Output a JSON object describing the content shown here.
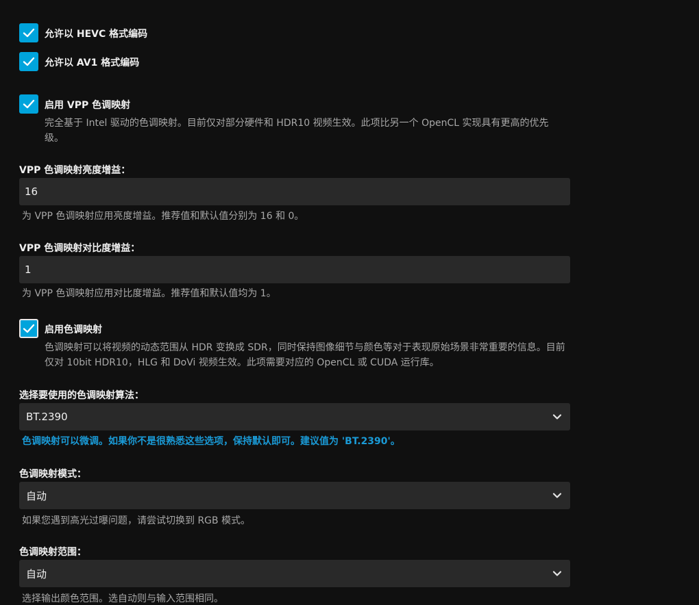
{
  "checkboxes": {
    "hevc": {
      "label": "允许以 HEVC 格式编码",
      "checked": true
    },
    "av1": {
      "label": "允许以 AV1 格式编码",
      "checked": true
    },
    "vpp_tonemap": {
      "label": "启用 VPP 色调映射",
      "checked": true,
      "description": "完全基于 Intel 驱动的色调映射。目前仅对部分硬件和 HDR10 视频生效。此项比另一个 OpenCL 实现具有更高的优先级。"
    },
    "tonemap": {
      "label": "启用色调映射",
      "checked": true,
      "description": "色调映射可以将视频的动态范围从 HDR 变换成 SDR，同时保持图像细节与颜色等对于表现原始场景非常重要的信息。目前仅对 10bit HDR10，HLG 和 DoVi 视频生效。此项需要对应的 OpenCL 或 CUDA 运行库。"
    }
  },
  "fields": {
    "vpp_brightness": {
      "label": "VPP 色调映射亮度增益：",
      "value": "16",
      "hint": "为 VPP 色调映射应用亮度增益。推荐值和默认值分别为 16 和 0。"
    },
    "vpp_contrast": {
      "label": "VPP 色调映射对比度增益：",
      "value": "1",
      "hint": "为 VPP 色调映射应用对比度增益。推荐值和默认值均为 1。"
    },
    "algorithm": {
      "label": "选择要使用的色调映射算法：",
      "value": "BT.2390",
      "hint": "色调映射可以微调。如果你不是很熟悉这些选项，保持默认即可。建议值为 'BT.2390'。"
    },
    "mode": {
      "label": "色调映射模式：",
      "value": "自动",
      "hint": "如果您遇到高光过曝问题，请尝试切换到 RGB 模式。"
    },
    "range": {
      "label": "色调映射范围：",
      "value": "自动",
      "hint": "选择输出颜色范围。选自动则与输入范围相同。"
    }
  },
  "colors": {
    "accent": "#00a4dc",
    "background": "#101010",
    "input_bg": "#292929"
  },
  "icons": {
    "checkmark": "check-icon",
    "dropdown": "chevron-down-icon"
  }
}
